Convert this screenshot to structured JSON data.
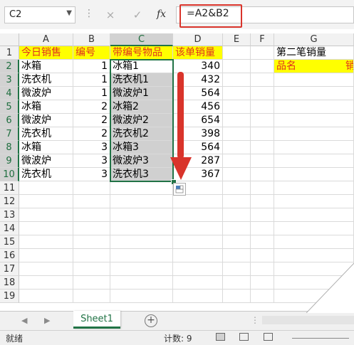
{
  "formula_bar": {
    "name_box": "C2",
    "cancel_icon": "×",
    "enter_icon": "✓",
    "fx_label": "fx",
    "formula": "=A2&B2"
  },
  "columns": [
    "A",
    "B",
    "C",
    "D",
    "E",
    "F",
    "G"
  ],
  "rows": [
    "1",
    "2",
    "3",
    "4",
    "5",
    "6",
    "7",
    "8",
    "9",
    "10",
    "11",
    "12",
    "13",
    "14",
    "15",
    "16",
    "17",
    "18",
    "19"
  ],
  "table": {
    "headers": [
      "今日销售",
      "编号",
      "带编号物品",
      "该单销量"
    ],
    "data": [
      [
        "冰箱",
        "1",
        "冰箱1",
        "340"
      ],
      [
        "洗衣机",
        "1",
        "洗衣机1",
        "432"
      ],
      [
        "微波炉",
        "1",
        "微波炉1",
        "564"
      ],
      [
        "冰箱",
        "2",
        "冰箱2",
        "456"
      ],
      [
        "微波炉",
        "2",
        "微波炉2",
        "654"
      ],
      [
        "洗衣机",
        "2",
        "洗衣机2",
        "398"
      ],
      [
        "冰箱",
        "3",
        "冰箱3",
        "564"
      ],
      [
        "微波炉",
        "3",
        "微波炉3",
        "287"
      ],
      [
        "洗衣机",
        "3",
        "洗衣机3",
        "367"
      ]
    ]
  },
  "side": {
    "g1": "第二笔销量",
    "g2": "品名",
    "h2": "销"
  },
  "sheet_tab": "Sheet1",
  "add_sheet": "+",
  "status": {
    "ready": "就绪",
    "count": "计数: 9"
  },
  "colors": {
    "accent": "#217346",
    "header_fill": "#ffff00",
    "header_text": "#e0301e",
    "arrow": "#d9342b"
  }
}
